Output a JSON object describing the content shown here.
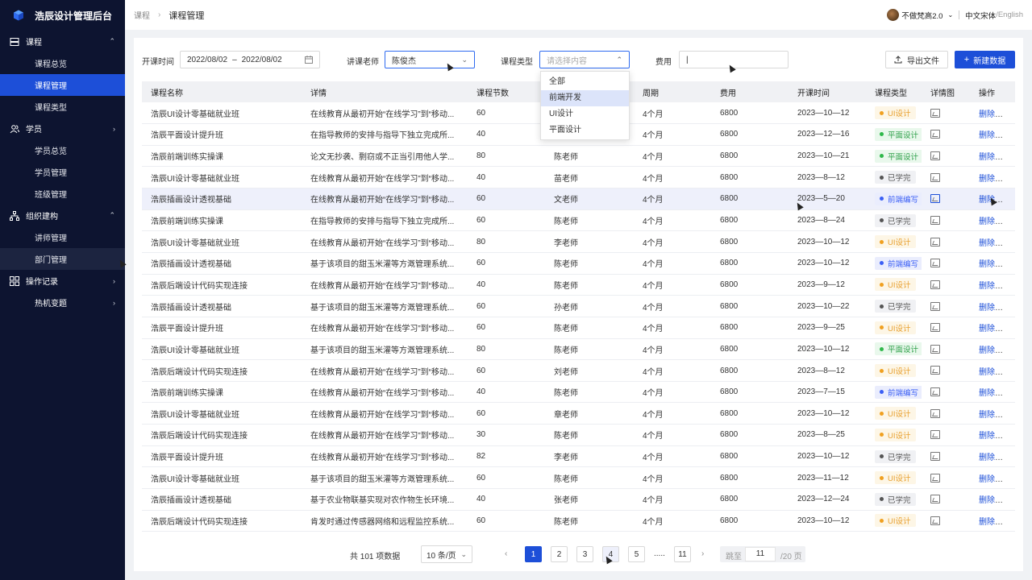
{
  "app": {
    "title": "浩辰设计管理后台"
  },
  "sidebar": {
    "groups": [
      {
        "label": "课程",
        "icon": "course-icon",
        "expanded": true,
        "items": [
          "课程总览",
          "课程管理",
          "课程类型"
        ]
      },
      {
        "label": "学员",
        "icon": "user-icon",
        "expanded": false,
        "items": [
          "学员总览",
          "学员管理",
          "班级管理"
        ]
      },
      {
        "label": "组织建构",
        "icon": "org-icon",
        "expanded": true,
        "items": [
          "讲师管理",
          "部门管理"
        ]
      },
      {
        "label": "操作记录",
        "icon": "grid-icon",
        "expanded": false,
        "items": []
      },
      {
        "label": "热机变题",
        "icon": "",
        "expanded": false,
        "items": []
      }
    ],
    "active_item": "课程管理",
    "hover_item": "部门管理"
  },
  "topbar": {
    "breadcrumb": [
      "课程",
      "课程管理"
    ],
    "user": "不做梵高2.0",
    "lang_cn": "中文宋体",
    "lang_sep": "/",
    "lang_en": "English"
  },
  "filters": {
    "date_label": "开课时间",
    "date_start": "2022/08/02",
    "date_sep": "–",
    "date_end": "2022/08/02",
    "teacher_label": "讲课老师",
    "teacher_value": "陈俊杰",
    "type_label": "课程类型",
    "type_placeholder": "请选择内容",
    "fee_label": "费用",
    "fee_value": "|",
    "export_label": "导出文件",
    "new_label": "新建数据"
  },
  "type_dropdown": {
    "options": [
      "全部",
      "前端开发",
      "UI设计",
      "平面设计"
    ],
    "highlighted": "前端开发"
  },
  "table": {
    "headers": [
      "课程名称",
      "详情",
      "课程节数",
      "",
      "周期",
      "费用",
      "开课时间",
      "课程类型",
      "详情图",
      "操作"
    ],
    "action_delete": "删除",
    "action_edit": "修改",
    "highlight_row": 4,
    "rows": [
      [
        "浩辰UI设计零基础就业班",
        "在线教育从最初开始“在线学习”到“移动...",
        "60",
        "",
        "4个月",
        "6800",
        "2023—10—12",
        "UI设计"
      ],
      [
        "浩辰平面设计提升班",
        "在指导教师的安排与指导下独立完成所...",
        "40",
        "",
        "4个月",
        "6800",
        "2023—12—16",
        "平面设计"
      ],
      [
        "浩辰前端训练实操课",
        "论文无抄袭、剽窃或不正当引用他人学...",
        "80",
        "陈老师",
        "4个月",
        "6800",
        "2023—10—21",
        "平面设计"
      ],
      [
        "浩辰UI设计零基础就业班",
        "在线教育从最初开始“在线学习”到“移动...",
        "40",
        "苗老师",
        "4个月",
        "6800",
        "2023—8—12",
        "已学完"
      ],
      [
        "浩辰插画设计透视基础",
        "在线教育从最初开始“在线学习”到“移动...",
        "60",
        "文老师",
        "4个月",
        "6800",
        "2023—5—20",
        "前端编写"
      ],
      [
        "浩辰前端训练实操课",
        "在指导教师的安排与指导下独立完成所...",
        "60",
        "陈老师",
        "4个月",
        "6800",
        "2023—8—24",
        "已学完"
      ],
      [
        "浩辰UI设计零基础就业班",
        "在线教育从最初开始“在线学习”到“移动...",
        "80",
        "李老师",
        "4个月",
        "6800",
        "2023—10—12",
        "UI设计"
      ],
      [
        "浩辰插画设计透视基础",
        "基于该项目的甜玉米灌等方溉管理系统...",
        "60",
        "陈老师",
        "4个月",
        "6800",
        "2023—10—12",
        "前端编写"
      ],
      [
        "浩辰后端设计代码实现连接",
        "在线教育从最初开始“在线学习”到“移动...",
        "40",
        "陈老师",
        "4个月",
        "6800",
        "2023—9—12",
        "UI设计"
      ],
      [
        "浩辰插画设计透视基础",
        "基于该项目的甜玉米灌等方溉管理系统...",
        "60",
        "孙老师",
        "4个月",
        "6800",
        "2023—10—22",
        "已学完"
      ],
      [
        "浩辰平面设计提升班",
        "在线教育从最初开始“在线学习”到“移动...",
        "60",
        "陈老师",
        "4个月",
        "6800",
        "2023—9—25",
        "UI设计"
      ],
      [
        "浩辰UI设计零基础就业班",
        "基于该项目的甜玉米灌等方溉管理系统...",
        "80",
        "陈老师",
        "4个月",
        "6800",
        "2023—10—12",
        "平面设计"
      ],
      [
        "浩辰后端设计代码实现连接",
        "在线教育从最初开始“在线学习”到“移动...",
        "60",
        "刘老师",
        "4个月",
        "6800",
        "2023—8—12",
        "UI设计"
      ],
      [
        "浩辰前端训练实操课",
        "在线教育从最初开始“在线学习”到“移动...",
        "40",
        "陈老师",
        "4个月",
        "6800",
        "2023—7—15",
        "前端编写"
      ],
      [
        "浩辰UI设计零基础就业班",
        "在线教育从最初开始“在线学习”到“移动...",
        "60",
        "章老师",
        "4个月",
        "6800",
        "2023—10—12",
        "UI设计"
      ],
      [
        "浩辰后端设计代码实现连接",
        "在线教育从最初开始“在线学习”到“移动...",
        "30",
        "陈老师",
        "4个月",
        "6800",
        "2023—8—25",
        "UI设计"
      ],
      [
        "浩辰平面设计提升班",
        "在线教育从最初开始“在线学习”到“移动...",
        "82",
        "李老师",
        "4个月",
        "6800",
        "2023—10—12",
        "已学完"
      ],
      [
        "浩辰UI设计零基础就业班",
        "基于该项目的甜玉米灌等方溉管理系统...",
        "60",
        "陈老师",
        "4个月",
        "6800",
        "2023—11—12",
        "UI设计"
      ],
      [
        "浩辰插画设计透视基础",
        "基于农业物联基实现对农作物生长环境...",
        "40",
        "张老师",
        "4个月",
        "6800",
        "2023—12—24",
        "已学完"
      ],
      [
        "浩辰后端设计代码实现连接",
        "肯发时通过传感器网络和远程监控系统...",
        "60",
        "陈老师",
        "4个月",
        "6800",
        "2023—10—12",
        "UI设计"
      ]
    ]
  },
  "tag_styles": {
    "UI设计": {
      "bg": "#fdf6e6",
      "dot": "#f0a020",
      "fg": "#e8a030"
    },
    "平面设计": {
      "bg": "#e9f8ec",
      "dot": "#2fb84a",
      "fg": "#2fa04a"
    },
    "已学完": {
      "bg": "#f0f1f4",
      "dot": "#555555",
      "fg": "#555555"
    },
    "前端编写": {
      "bg": "#eaedfd",
      "dot": "#3b5ff5",
      "fg": "#3b5ff5"
    }
  },
  "pagination": {
    "total_text": "共 101 项数据",
    "page_size": "10 条/页",
    "pages": [
      "1",
      "2",
      "3",
      "4",
      "5"
    ],
    "current": "1",
    "hover": "4",
    "dots": ".....",
    "last": "11",
    "jump_label": "跳至",
    "jump_value": "11",
    "jump_total": "/20 页"
  },
  "colors": {
    "accent": "#1d4fd8",
    "sidebar_bg": "#0d1430"
  }
}
